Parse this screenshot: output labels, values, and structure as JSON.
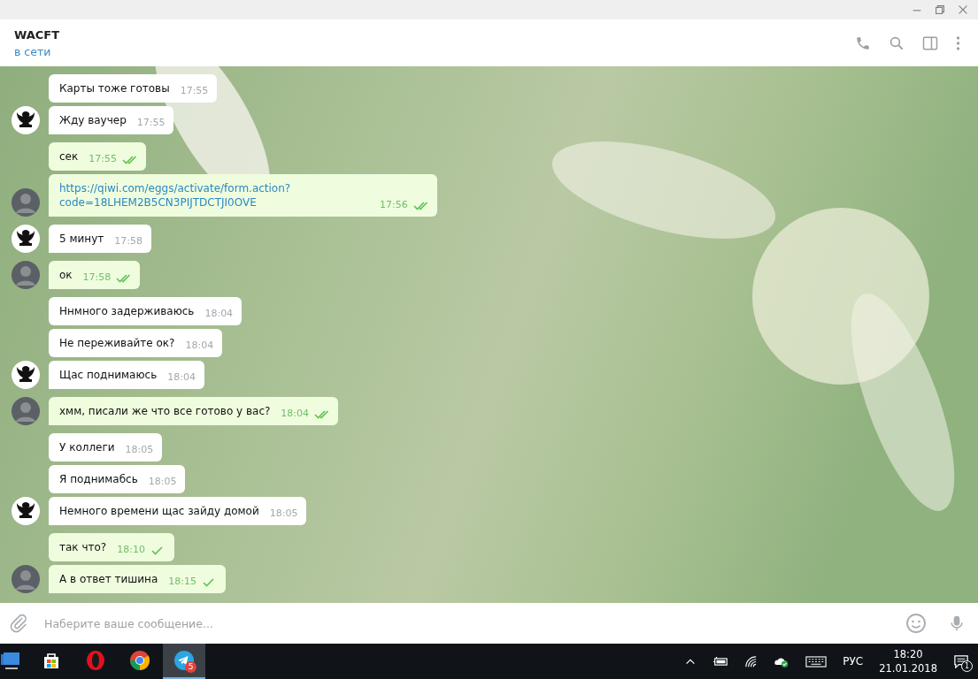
{
  "chat_header": {
    "title": "WACFT",
    "status": "в сети"
  },
  "messages": [
    {
      "kind": "incoming",
      "text": "Карты тоже готовы",
      "time": "17:55"
    },
    {
      "kind": "incoming",
      "text": "Жду ваучер",
      "time": "17:55"
    },
    {
      "kind": "outgoing",
      "text": "сек",
      "time": "17:55",
      "read": true
    },
    {
      "kind": "outgoing-link",
      "text": "https://qiwi.com/eggs/activate/form.action?code=18LHEM2B5CN3PIJTDCTJI0OVE",
      "time": "17:56",
      "read": true
    },
    {
      "kind": "incoming",
      "text": "5 минут",
      "time": "17:58"
    },
    {
      "kind": "outgoing",
      "text": "ок",
      "time": "17:58",
      "read": true
    },
    {
      "kind": "incoming",
      "text": "Ннмного задерживаюсь",
      "time": "18:04"
    },
    {
      "kind": "incoming",
      "text": "Не переживайте ок?",
      "time": "18:04"
    },
    {
      "kind": "incoming",
      "text": "Щас поднимаюсь",
      "time": "18:04"
    },
    {
      "kind": "outgoing",
      "text": "хмм, писали же что все готово у вас?",
      "time": "18:04",
      "read": true
    },
    {
      "kind": "incoming",
      "text": "У коллеги",
      "time": "18:05"
    },
    {
      "kind": "incoming",
      "text": "Я поднимабсь",
      "time": "18:05"
    },
    {
      "kind": "incoming",
      "text": "Немного времени щас зайду домой",
      "time": "18:05"
    },
    {
      "kind": "outgoing",
      "text": "так что?",
      "time": "18:10",
      "read": false
    },
    {
      "kind": "outgoing",
      "text": "А в ответ тишина",
      "time": "18:15",
      "read": false
    }
  ],
  "composer": {
    "placeholder": "Наберите ваше сообщение..."
  },
  "taskbar": {
    "apps": [
      {
        "kind": "start"
      },
      {
        "kind": "store",
        "selected": false
      },
      {
        "kind": "opera",
        "selected": false
      },
      {
        "kind": "chrome",
        "selected": false
      },
      {
        "kind": "telegram",
        "selected": true,
        "badge": "5"
      }
    ],
    "language": "РУС",
    "time": "18:20",
    "date": "21.01.2018",
    "notifications": "1"
  }
}
